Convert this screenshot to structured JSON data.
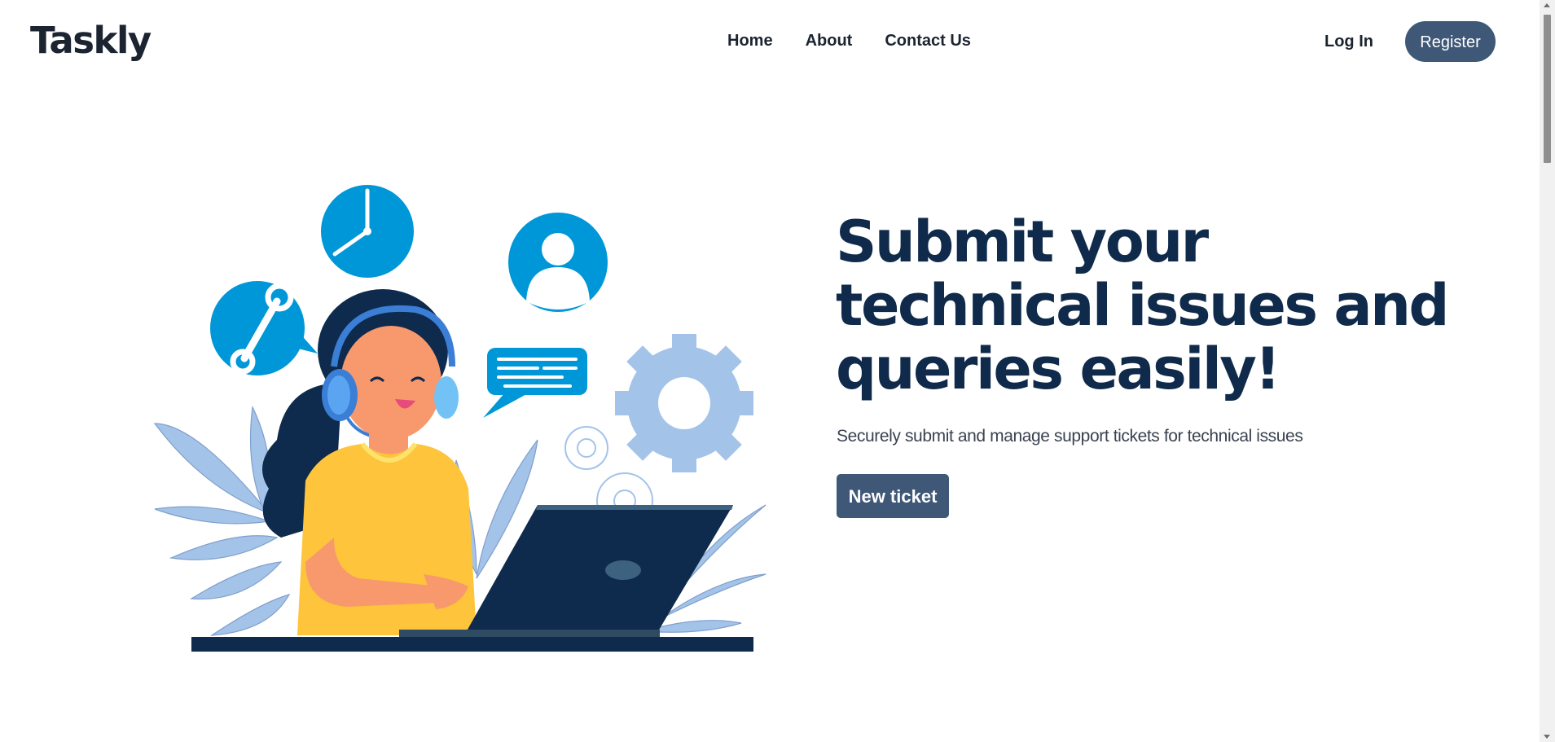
{
  "header": {
    "brand": "Taskly",
    "nav": [
      {
        "label": "Home"
      },
      {
        "label": "About"
      },
      {
        "label": "Contact Us"
      }
    ],
    "login_label": "Log In",
    "register_label": "Register"
  },
  "hero": {
    "title": "Submit your technical issues and queries easily!",
    "subtitle": "Securely submit and manage support tickets for technical issues",
    "cta_label": "New ticket",
    "illustration": "customer-support-agent-with-headset-at-laptop"
  },
  "colors": {
    "primary_button": "#3f5877",
    "heading": "#0f2a4a",
    "icon_blue": "#0097d8",
    "leaf_blue": "#a4c3e9",
    "shirt_yellow": "#fdc43c",
    "laptop_navy": "#0e2a4c"
  },
  "icons": [
    "clock-icon",
    "user-icon",
    "wrench-icon",
    "chat-bubble-icon",
    "gear-icon"
  ]
}
